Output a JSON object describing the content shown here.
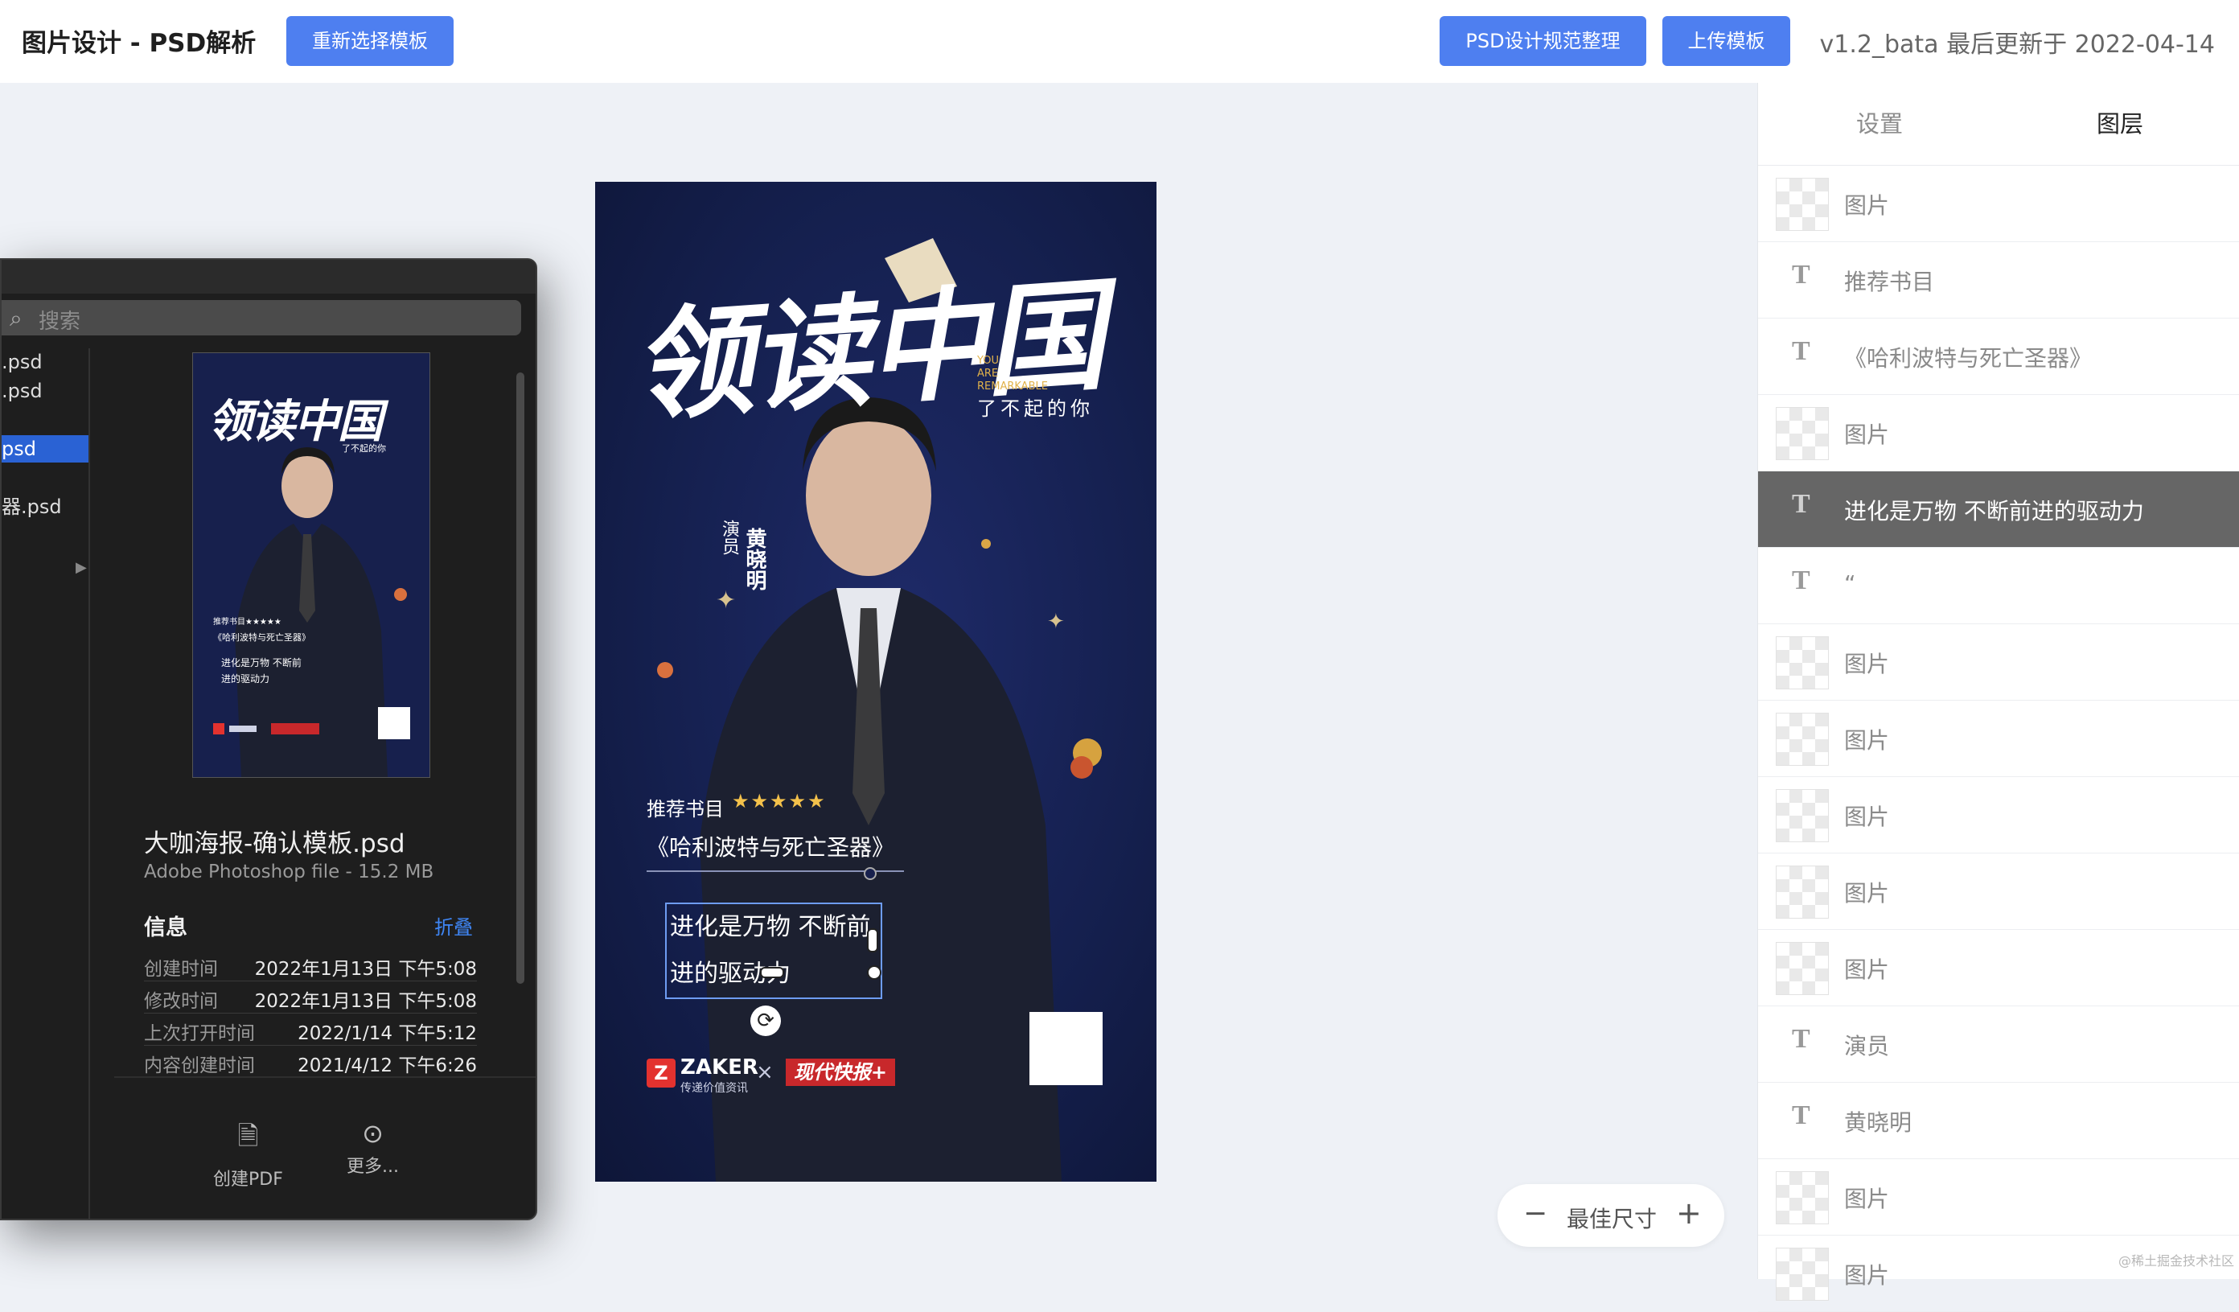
{
  "header": {
    "title": "图片设计 - PSD解析",
    "reselect_btn": "重新选择模板",
    "spec_btn": "PSD设计规范整理",
    "upload_btn": "上传模板",
    "version": "v1.2_bata 最后更新于 2022-04-14"
  },
  "right_panel": {
    "tabs": [
      {
        "label": "设置"
      },
      {
        "label": "图层"
      }
    ],
    "active_tab": "图层",
    "layers": [
      {
        "type": "image",
        "name": "图片"
      },
      {
        "type": "text",
        "name": "推荐书目"
      },
      {
        "type": "text",
        "name": "《哈利波特与死亡圣器》"
      },
      {
        "type": "image",
        "name": "图片"
      },
      {
        "type": "text",
        "name": "进化是万物 不断前进的驱动力",
        "selected": true
      },
      {
        "type": "text",
        "name": "“"
      },
      {
        "type": "image",
        "name": "图片"
      },
      {
        "type": "image",
        "name": "图片"
      },
      {
        "type": "image",
        "name": "图片"
      },
      {
        "type": "image",
        "name": "图片"
      },
      {
        "type": "image",
        "name": "图片"
      },
      {
        "type": "text",
        "name": "演员"
      },
      {
        "type": "text",
        "name": "黄晓明"
      },
      {
        "type": "image",
        "name": "图片"
      },
      {
        "type": "image",
        "name": "图片"
      }
    ]
  },
  "poster": {
    "title": "领读中国",
    "you_are": "YOU\nARE\nREMARKABLE",
    "subtitle": "了不起的你",
    "role": "演员",
    "name": "黄晓明",
    "recommend": "推荐书目",
    "stars": "★★★★★",
    "book": "《哈利波特与死亡圣器》",
    "quote": "进化是万物 不断前进的驱动力",
    "zaker": "ZAKER",
    "zaker_sub": "传递价值资讯",
    "cross": "×",
    "partner": "现代快报+"
  },
  "zoom": {
    "minus": "−",
    "label": "最佳尺寸",
    "plus": "+"
  },
  "finder": {
    "search_placeholder": "搜索",
    "files": [
      ".psd",
      " .psd",
      "psd",
      "器.psd"
    ],
    "preview": {
      "title": "领读中国",
      "sub": "了不起的你",
      "rec": "推荐书目★★★★★",
      "book": "《哈利波特与死亡圣器》",
      "quote": "进化是万物 不断前进的驱动力"
    },
    "file_name": "大咖海报-确认模板.psd",
    "file_kind": "Adobe Photoshop file - 15.2 MB",
    "info_title": "信息",
    "info_fold": "折叠",
    "info_rows": [
      {
        "k": "创建时间",
        "v": "2022年1月13日 下午5:08"
      },
      {
        "k": "修改时间",
        "v": "2022年1月13日 下午5:08"
      },
      {
        "k": "上次打开时间",
        "v": "2022/1/14 下午5:12"
      },
      {
        "k": "内容创建时间",
        "v": "2021/4/12 下午6:26"
      }
    ],
    "actions": [
      {
        "label": "创建PDF"
      },
      {
        "label": "更多..."
      }
    ]
  },
  "watermark": "@稀土掘金技术社区",
  "colors": {
    "accent": "#4e7ff0",
    "poster_bg": "#15204f",
    "selected_layer": "#666666",
    "finder_select": "#2a62d4"
  }
}
